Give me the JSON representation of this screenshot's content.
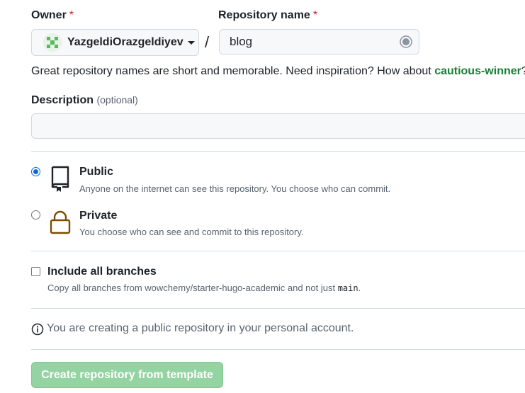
{
  "owner": {
    "label": "Owner",
    "required_mark": "*",
    "value": "YazgeldiOrazgeldiyev"
  },
  "separator": "/",
  "repo_name": {
    "label": "Repository name",
    "required_mark": "*",
    "value": "blog"
  },
  "hint": {
    "text": "Great repository names are short and memorable. Need inspiration? How about ",
    "suggestion": "cautious-winner",
    "end": "?"
  },
  "description": {
    "label": "Description",
    "optional": "(optional)",
    "value": ""
  },
  "visibility": {
    "public": {
      "title": "Public",
      "desc": "Anyone on the internet can see this repository. You choose who can commit.",
      "selected": true
    },
    "private": {
      "title": "Private",
      "desc": "You choose who can see and commit to this repository.",
      "selected": false
    }
  },
  "branches": {
    "label": "Include all branches",
    "desc_prefix": "Copy all branches from wowchemy/starter-hugo-academic and not just ",
    "code": "main",
    "desc_suffix": ".",
    "checked": false
  },
  "info": {
    "text": "You are creating a public repository in your personal account."
  },
  "submit": {
    "label": "Create repository from template"
  },
  "colors": {
    "accent_blue": "#0969da",
    "suggestion_green": "#1a7f37",
    "button_green_disabled": "#94d3a2",
    "lock_brown": "#7d4e00"
  }
}
